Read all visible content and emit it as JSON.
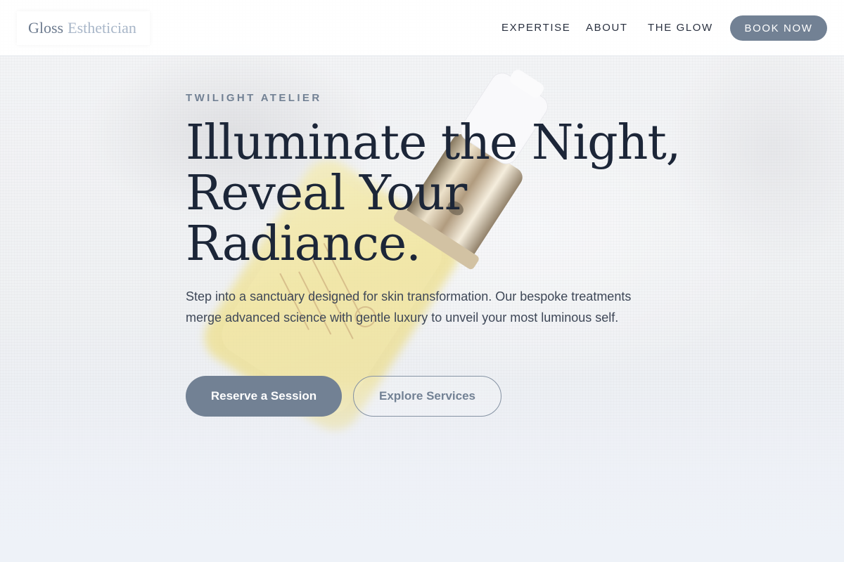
{
  "header": {
    "logo": {
      "primary": "Gloss",
      "secondary": "Esthetician"
    },
    "nav": [
      {
        "label": "EXPERTISE"
      },
      {
        "label": "ABOUT"
      },
      {
        "label": "THE GLOW"
      }
    ],
    "cta_label": "BOOK NOW"
  },
  "hero": {
    "eyebrow": "TWILIGHT ATELIER",
    "headline_lines": [
      "Illuminate the Night,",
      "Reveal Your",
      "Radiance."
    ],
    "lede": "Step into a sanctuary designed for skin transformation. Our bespoke treatments merge advanced science with gentle luxury to unveil your most luminous self.",
    "primary_button": "Reserve a Session",
    "secondary_button": "Explore Services"
  },
  "theme": {
    "accent": "#728194",
    "heading": "#1c2638",
    "body_text": "#3e4757",
    "logo_primary": "#6d7b8f",
    "logo_secondary": "#a8b6c8"
  }
}
